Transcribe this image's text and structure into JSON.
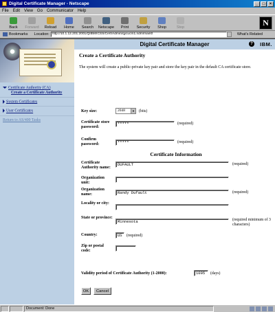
{
  "window": {
    "title": "Digital Certificate Manager - Netscape"
  },
  "menu": [
    "File",
    "Edit",
    "View",
    "Go",
    "Communicator",
    "Help"
  ],
  "toolbar": [
    {
      "label": "Back",
      "icon": "back-arrow-icon",
      "color": "#3a9a3a",
      "enabled": true
    },
    {
      "label": "Forward",
      "icon": "forward-arrow-icon",
      "color": "#a0a0a0",
      "enabled": false
    },
    {
      "label": "Reload",
      "icon": "reload-icon",
      "color": "#d0a030",
      "enabled": true
    },
    {
      "label": "Home",
      "icon": "home-icon",
      "color": "#5070c0",
      "enabled": true
    },
    {
      "label": "Search",
      "icon": "search-icon",
      "color": "#909090",
      "enabled": true
    },
    {
      "label": "Netscape",
      "icon": "netscape-icon",
      "color": "#406080",
      "enabled": true
    },
    {
      "label": "Print",
      "icon": "print-icon",
      "color": "#707070",
      "enabled": true
    },
    {
      "label": "Security",
      "icon": "lock-icon",
      "color": "#c0a040",
      "enabled": true
    },
    {
      "label": "Shop",
      "icon": "shop-icon",
      "color": "#6080c0",
      "enabled": true
    },
    {
      "label": "Stop",
      "icon": "stop-icon",
      "color": "#b0b0b0",
      "enabled": false
    }
  ],
  "logo": "N",
  "location": {
    "bookmarks_label": "Bookmarks",
    "location_label": "Location:",
    "url": "http://10.1.12.201:2001/QIBM/ICSS/Cert/Admin/qycucm1.ndm/main0",
    "related_label": "What's Related"
  },
  "sidebar": {
    "items": [
      {
        "label": "Certificate Authority (CA)",
        "open": true
      },
      {
        "label": "System Certificates",
        "open": false
      },
      {
        "label": "User Certificates",
        "open": false
      }
    ],
    "subitem": "Create a Certificate Authority",
    "return_link": "Return to AS/400 Tasks"
  },
  "header": {
    "title": "Digital Certificate Manager",
    "help": "?",
    "brand": "IBM."
  },
  "page": {
    "title": "Create a Certificate Authority",
    "intro": "The system will create a public-private key pair and store the key pair in the default CA certificate store."
  },
  "form": {
    "key_size_label": "Key size:",
    "key_size_value": "2048",
    "key_size_unit": "(bits)",
    "store_password_label": "Certificate store password:",
    "store_password_value": "*****",
    "confirm_password_label": "Confirm password:",
    "confirm_password_value": "*****",
    "required": "(required)",
    "section_title": "Certificate Information",
    "ca_name_label": "Certificate Authority name:",
    "ca_name_value": "DUFAULT",
    "org_unit_label": "Organization unit:",
    "org_unit_value": "",
    "org_name_label": "Organization name:",
    "org_name_value": "Randy Dufault",
    "locality_label": "Locality or city:",
    "locality_value": "",
    "state_label": "State or province:",
    "state_value": "Minnesota",
    "state_note": "(required minimum of 3 characters)",
    "country_label": "Country:",
    "country_value": "US",
    "zip_label": "Zip or postal code:",
    "zip_value": "",
    "validity_label": "Validity period of Certificate Authority (1-2000):",
    "validity_value": "1095",
    "validity_unit": "(days)",
    "ok_label": "OK",
    "cancel_label": "Cancel"
  },
  "status": {
    "text": "Document: Done"
  }
}
